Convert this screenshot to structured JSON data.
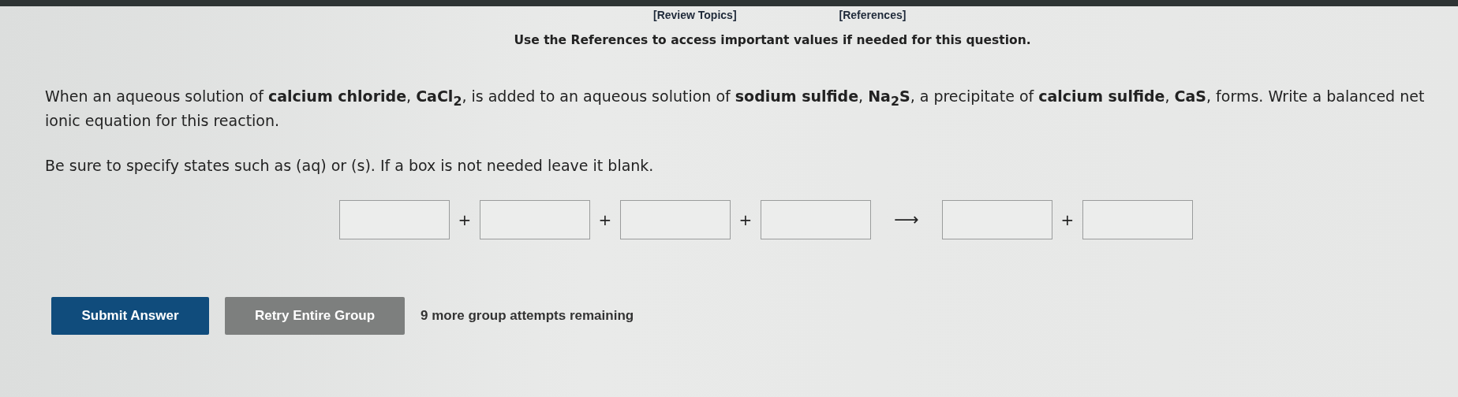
{
  "top_links": [
    "[Review Topics]",
    "[References]"
  ],
  "instruction": "Use the References to access important values if needed for this question.",
  "question": "When an aqueous solution of **calcium chloride**, **CaCl$_{2}$**, is added to an aqueous solution of **sodium sulfide**, **Na$_{2}$S**, a precipitate of **calcium sulfide**, **CaS**, forms. Write a balanced net ionic equation for this reaction.",
  "hint": "Be sure to specify states such as (aq) or (s). If a box is not needed leave it blank.",
  "equation": [
    {
      "kind": "box"
    },
    {
      "kind": "plus",
      "text": "+"
    },
    {
      "kind": "box"
    },
    {
      "kind": "plus",
      "text": "+"
    },
    {
      "kind": "box"
    },
    {
      "kind": "plus",
      "text": "+"
    },
    {
      "kind": "box"
    },
    {
      "kind": "arrow",
      "text": "⟶"
    },
    {
      "kind": "box"
    },
    {
      "kind": "plus",
      "text": "+"
    },
    {
      "kind": "box"
    }
  ],
  "buttons": [
    {
      "kind": "primary",
      "label": "Submit Answer"
    },
    {
      "kind": "secondary",
      "label": "Retry Entire Group"
    }
  ],
  "attempts": "9 more group attempts remaining"
}
